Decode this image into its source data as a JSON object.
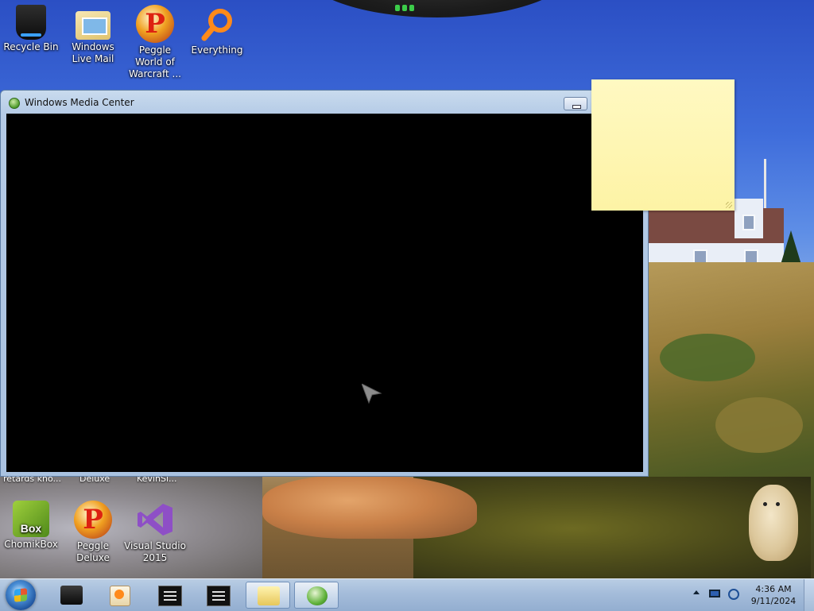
{
  "desktop": {
    "icons_top": [
      {
        "label": "Recycle Bin"
      },
      {
        "label": "Windows Live Mail"
      },
      {
        "label": "Peggle World of Warcraft ..."
      },
      {
        "label": "Everything"
      }
    ],
    "icons_bottom": [
      {
        "label": "ChomikBox"
      },
      {
        "label": "Peggle Deluxe"
      },
      {
        "label": "Visual Studio 2015"
      }
    ],
    "clipped_labels": [
      "retards kno...",
      "Deluxe",
      "KevinSi..."
    ],
    "chomik_icon_text": "Box",
    "peggle_icon_letter": "P"
  },
  "window": {
    "title": "Windows Media Center"
  },
  "taskbar": {
    "clock_time": "4:36 AM",
    "clock_date": "9/11/2024"
  },
  "colors": {
    "taskbar": "#a4bcda",
    "window_frame": "#b5cbe6",
    "sticky_note": "#fdf3a5",
    "media_area": "#000000"
  }
}
